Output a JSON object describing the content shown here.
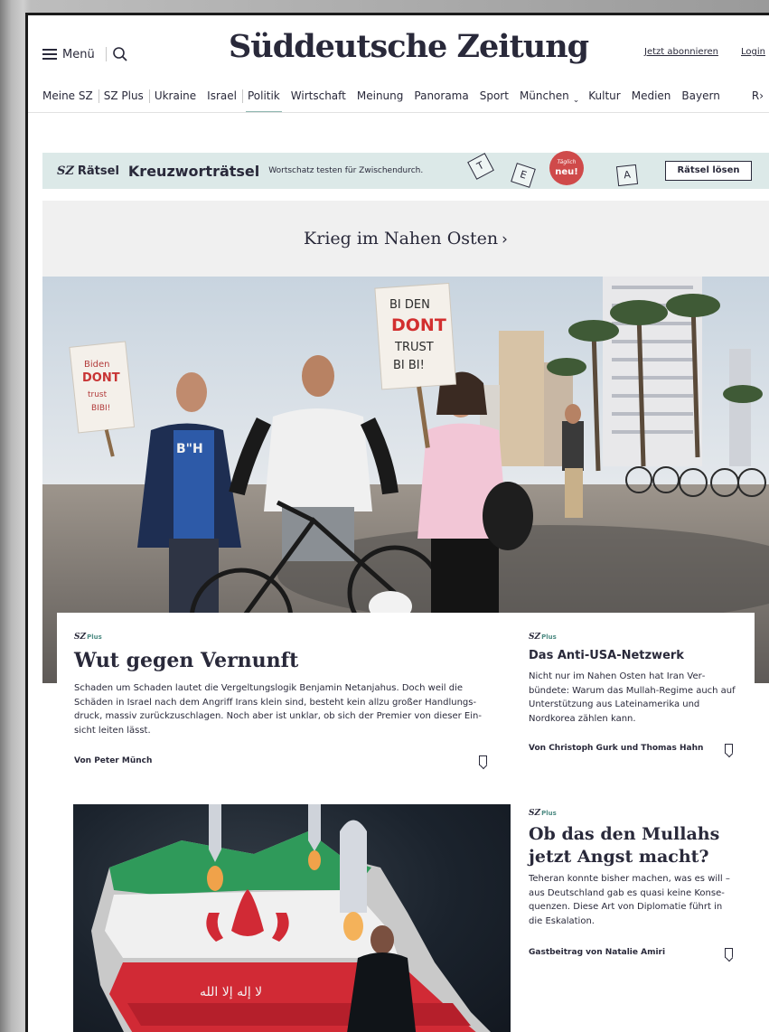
{
  "header": {
    "menu_label": "Menü",
    "logo": "Süddeutsche Zeitung",
    "subscribe_label": "Jetzt abonnieren",
    "login_label": "Login"
  },
  "nav": {
    "items": [
      "Meine SZ",
      "SZ Plus",
      "Ukraine",
      "Israel",
      "Politik",
      "Wirtschaft",
      "Meinung",
      "Panorama",
      "Sport",
      "München",
      "Kultur",
      "Medien",
      "Bayern"
    ],
    "overflow": "R",
    "active": "Politik",
    "accent_color": "#8fb6b0"
  },
  "promo": {
    "brand_sz": "SZ",
    "brand_raetsel": "Rätsel",
    "title": "Kreuzworträtsel",
    "subtitle": "Wortschatz testen für Zwischendurch.",
    "tiles": [
      "T",
      "E",
      "A"
    ],
    "badge_top": "Täglich",
    "badge_main": "neu!",
    "button_label": "Rätsel lösen",
    "background_color": "#dce9e8",
    "badge_color": "#cf4a4a"
  },
  "section": {
    "title": "Krieg im Nahen Osten",
    "chevron": "›"
  },
  "hero": {
    "sign_left": [
      "Biden",
      "DONT",
      "trust",
      "BIBI!"
    ],
    "sign_right": [
      "BI DEN",
      "DONT",
      "TRUST",
      "BI BI!"
    ],
    "shirt_text": "B\"H"
  },
  "lead": {
    "kicker_sz": "SZ",
    "kicker_plus": "Plus",
    "title": "Wut gegen Vernunft",
    "body": "Schaden um Schaden lautet die Vergeltungslogik Benjamin Netanjahus. Doch weil die Schäden in Israel nach dem Angriff Irans klein sind, besteht kein allzu großer Handlungs­druck, massiv zurückzuschlagen. Noch aber ist unklar, ob sich der Premier von dieser Ein­sicht leiten lässt.",
    "author": "Von Peter Münch"
  },
  "side": {
    "kicker_sz": "SZ",
    "kicker_plus": "Plus",
    "title": "Das Anti-USA-Netzwerk",
    "body": "Nicht nur im Nahen Osten hat Iran Ver­bündete: Warum das Mullah-Regime auch auf Unterstützung aus Lateinamerika und Nordkorea zählen kann.",
    "author": "Von Christoph Gurk und Thomas Hahn"
  },
  "row2": {
    "kicker_sz": "SZ",
    "kicker_plus": "Plus",
    "title": "Ob das den Mullahs jetzt Angst macht?",
    "body": "Teheran konnte bisher machen, was es will – aus Deutschland gab es quasi keine Konse­quenzen. Diese Art von Diplomatie führt in die Eskalation.",
    "author": "Gastbeitrag von Natalie Amiri",
    "image_text": "لا إله إلا الله"
  },
  "icons": {
    "menu": "hamburger-icon",
    "search": "search-icon",
    "bookmark": "bookmark-icon",
    "nav_chevron": "chevron-down-icon"
  }
}
